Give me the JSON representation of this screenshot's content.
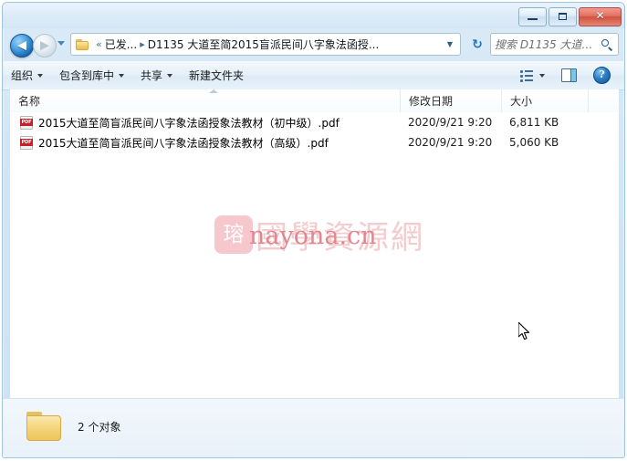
{
  "window": {
    "controls": {
      "minimize_label": "–",
      "maximize_label": "□",
      "close_label": "✕"
    }
  },
  "navigation": {
    "back_label": "◀",
    "forward_label": "▶",
    "history_caret": "▼",
    "refresh_label": "↻"
  },
  "address": {
    "overflow_label": "«",
    "crumb_1": "已发...",
    "separator": "▸",
    "crumb_2": "D1135 大道至简2015盲派民间八字象法函授...",
    "dropdown_caret": "▼"
  },
  "search": {
    "placeholder": "搜索 D1135 大道至简...",
    "value": ""
  },
  "toolbar": {
    "organize_label": "组织",
    "include_library_label": "包含到库中",
    "share_label": "共享",
    "new_folder_label": "新建文件夹",
    "view_caret": "▼",
    "help_label": "?"
  },
  "columns": {
    "name": "名称",
    "date_modified": "修改日期",
    "size": "大小"
  },
  "files": [
    {
      "name": "2015大道至简盲派民间八字象法函授象法教材（初中级）.pdf",
      "date": "2020/9/21 9:20",
      "size": "6,811 KB",
      "icon": "pdf-icon"
    },
    {
      "name": "2015大道至简盲派民间八字象法函授象法教材（高级）.pdf",
      "date": "2020/9/21 9:20",
      "size": "5,060 KB",
      "icon": "pdf-icon"
    }
  ],
  "watermark": {
    "logo_glyph": "瑢",
    "site_name_cn": "國學資源網",
    "site_url": "nayona.cn",
    "color_pale": "#f4ccce",
    "color_url": "#e2868f"
  },
  "status": {
    "item_count_label": "2 个对象"
  }
}
